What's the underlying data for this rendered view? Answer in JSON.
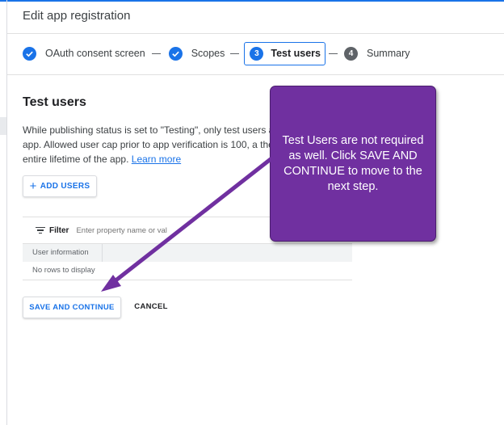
{
  "header": {
    "title": "Edit app registration"
  },
  "stepper": {
    "steps": [
      {
        "label": "OAuth consent screen",
        "state": "complete"
      },
      {
        "label": "Scopes",
        "state": "complete"
      },
      {
        "number": "3",
        "label": "Test users",
        "state": "active"
      },
      {
        "number": "4",
        "label": "Summary",
        "state": "pending"
      }
    ]
  },
  "section": {
    "title": "Test users",
    "description": "While publishing status is set to \"Testing\", only test users a the app. Allowed user cap prior to app verification is 100, a the entire lifetime of the app.",
    "learn_more": "Learn more"
  },
  "add_users": {
    "label": "ADD USERS",
    "icon": "plus-icon"
  },
  "table": {
    "filter_label": "Filter",
    "filter_placeholder": "Enter property name or val",
    "columns": [
      "User information"
    ],
    "empty_text": "No rows to display"
  },
  "actions": {
    "save_label": "SAVE AND CONTINUE",
    "cancel_label": "CANCEL"
  },
  "callout": {
    "text": "Test Users are not required as well. Click SAVE AND CONTINUE to move to the next step.",
    "color": "#7030a0"
  },
  "colors": {
    "accent": "#1a73e8",
    "pending_step": "#5f6368"
  }
}
